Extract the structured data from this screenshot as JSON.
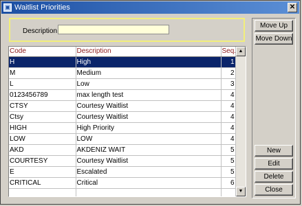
{
  "window": {
    "title": "Waitlist Priorities"
  },
  "filter": {
    "description_label": "Description",
    "description_value": ""
  },
  "grid": {
    "columns": {
      "code": "Code",
      "description": "Description",
      "seq": "Seq."
    },
    "rows": [
      {
        "code": "H",
        "description": "High",
        "seq": "1",
        "selected": true
      },
      {
        "code": "M",
        "description": "Medium",
        "seq": "2"
      },
      {
        "code": "L",
        "description": "Low",
        "seq": "3"
      },
      {
        "code": "0123456789",
        "description": "max length test",
        "seq": "4"
      },
      {
        "code": "CTSY",
        "description": "Courtesy Waitlist",
        "seq": "4"
      },
      {
        "code": "Ctsy",
        "description": "Courtesy Waitlist",
        "seq": "4"
      },
      {
        "code": "HIGH",
        "description": "High Priority",
        "seq": "4"
      },
      {
        "code": "LOW",
        "description": "LOW",
        "seq": "4"
      },
      {
        "code": "AKD",
        "description": "AKDENIZ WAIT",
        "seq": "5"
      },
      {
        "code": "COURTESY",
        "description": "Courtesy Waitlist",
        "seq": "5"
      },
      {
        "code": "E",
        "description": "Escalated",
        "seq": "5"
      },
      {
        "code": "CRITICAL",
        "description": "Critical",
        "seq": "6"
      },
      {
        "code": "",
        "description": "",
        "seq": ""
      }
    ]
  },
  "buttons": {
    "move_up": "Move Up",
    "move_down": "Move Down",
    "new": "New",
    "edit": "Edit",
    "delete": "Delete",
    "close": "Close"
  },
  "icons": {
    "app": "window-app-icon",
    "close": "close-icon",
    "scroll_up": "arrow-up-icon",
    "scroll_down": "arrow-down-icon"
  },
  "colors": {
    "title_bar": "#1c4fa3",
    "selection": "#0a246a",
    "header_text": "#8b1a1a",
    "filter_border": "#f2ef7a",
    "input_bg": "#ffffd9"
  }
}
